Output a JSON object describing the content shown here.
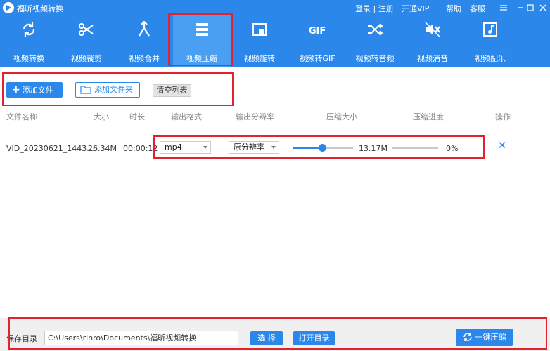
{
  "titlebar": {
    "app_title": "福昕视频转换",
    "login_register": "登录 | 注册",
    "vip": "开通VIP",
    "help": "帮助",
    "support": "客服",
    "icons": [
      "settings-icon",
      "minimize-icon",
      "maximize-icon",
      "close-icon"
    ]
  },
  "tools": [
    {
      "label": "视频转换",
      "icon": "convert-icon",
      "active": false
    },
    {
      "label": "视频裁剪",
      "icon": "scissors-icon",
      "active": false
    },
    {
      "label": "视频合并",
      "icon": "merge-icon",
      "active": false
    },
    {
      "label": "视频压缩",
      "icon": "compress-icon",
      "active": true
    },
    {
      "label": "视频旋转",
      "icon": "rotate-icon",
      "active": false
    },
    {
      "label": "视频转GIF",
      "icon": "gif-icon",
      "active": false
    },
    {
      "label": "视频转音频",
      "icon": "shuffle-icon",
      "active": false
    },
    {
      "label": "视频消音",
      "icon": "mute-icon",
      "active": false
    },
    {
      "label": "视频配乐",
      "icon": "music-icon",
      "active": false
    }
  ],
  "gif_glyph": "GIF",
  "actions": {
    "add_file": "添加文件",
    "add_folder": "添加文件夹",
    "clear_list": "清空列表"
  },
  "table": {
    "headers": {
      "name": "文件名称",
      "size": "大小",
      "duration": "时长",
      "format": "输出格式",
      "resolution": "输出分辨率",
      "compressed_size": "压缩大小",
      "progress": "压缩进度",
      "operation": "操作"
    },
    "rows": [
      {
        "name": "VID_20230621_1443...",
        "size": "26.34M",
        "duration": "00:00:12",
        "format": "mp4",
        "resolution": "原分辨率",
        "compression_level": 0.5,
        "compressed_size": "13.17M",
        "progress": "0%"
      }
    ]
  },
  "bottom": {
    "save_dir_label": "保存目录",
    "save_path": "C:\\Users\\rinro\\Documents\\福昕视频转换",
    "choose": "选 择",
    "open_dir": "打开目录",
    "compress_all": "一键压缩"
  },
  "colors": {
    "accent": "#2b88ea",
    "annotation": "#e0232c"
  }
}
